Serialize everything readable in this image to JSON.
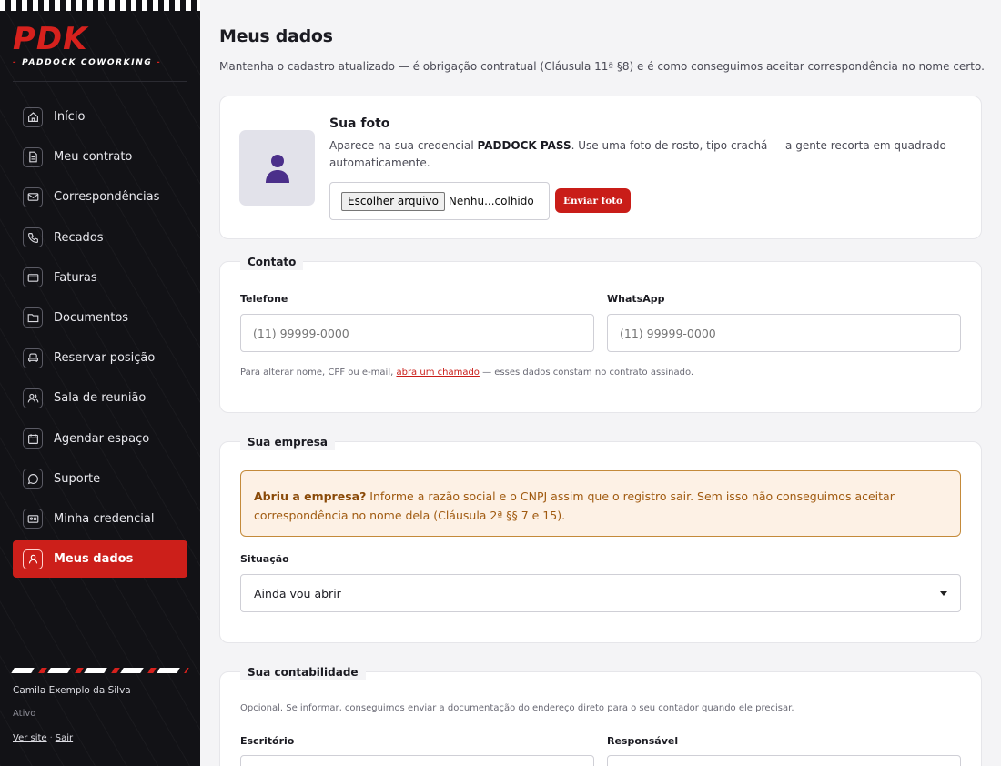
{
  "sidebar": {
    "logo": "PDK",
    "logo_sub_dash_left": "-",
    "logo_sub": "PADDOCK COWORKING",
    "logo_sub_dash_right": "-",
    "items": [
      {
        "label": "Início",
        "icon": "home-icon"
      },
      {
        "label": "Meu contrato",
        "icon": "document-icon"
      },
      {
        "label": "Correspondências",
        "icon": "mail-icon"
      },
      {
        "label": "Recados",
        "icon": "phone-icon"
      },
      {
        "label": "Faturas",
        "icon": "credit-card-icon"
      },
      {
        "label": "Documentos",
        "icon": "folder-icon"
      },
      {
        "label": "Reservar posição",
        "icon": "armchair-icon"
      },
      {
        "label": "Sala de reunião",
        "icon": "users-icon"
      },
      {
        "label": "Agendar espaço",
        "icon": "calendar-icon"
      },
      {
        "label": "Suporte",
        "icon": "chat-icon"
      },
      {
        "label": "Minha credencial",
        "icon": "id-card-icon"
      },
      {
        "label": "Meus dados",
        "icon": "user-icon",
        "active": true
      }
    ],
    "user_name": "Camila Exemplo da Silva",
    "user_status": "Ativo",
    "link_site": "Ver site",
    "link_sep": "·",
    "link_logout": "Sair"
  },
  "page": {
    "title": "Meus dados",
    "description": "Mantenha o cadastro atualizado — é obrigação contratual (Cláusula 11ª §8) e é como conseguimos aceitar correspondência no nome certo."
  },
  "photo": {
    "title": "Sua foto",
    "desc_prefix": "Aparece na sua credencial ",
    "desc_bold": "PADDOCK PASS",
    "desc_suffix": ". Use uma foto de rosto, tipo crachá — a gente recorta em quadrado automaticamente.",
    "file_button": "Escolher arquivo",
    "file_name": "Nenhu...colhido",
    "send_button": "Enviar foto"
  },
  "contato": {
    "legend": "Contato",
    "phone_label": "Telefone",
    "phone_placeholder": "(11) 99999-0000",
    "whatsapp_label": "WhatsApp",
    "whatsapp_placeholder": "(11) 99999-0000",
    "hint_prefix": "Para alterar nome, CPF ou e-mail, ",
    "hint_link": "abra um chamado",
    "hint_suffix": " — esses dados constam no contrato assinado."
  },
  "empresa": {
    "legend": "Sua empresa",
    "alert_bold": "Abriu a empresa?",
    "alert_text": " Informe a razão social e o CNPJ assim que o registro sair. Sem isso não conseguimos aceitar correspondência no nome dela (Cláusula 2ª §§ 7 e 15).",
    "situacao_label": "Situação",
    "situacao_value": "Ainda vou abrir"
  },
  "contabilidade": {
    "legend": "Sua contabilidade",
    "hint": "Opcional. Se informar, conseguimos enviar a documentação do endereço direto para o seu contador quando ele precisar.",
    "escritorio_label": "Escritório",
    "responsavel_label": "Responsável"
  },
  "colors": {
    "brand_red": "#cc1f1a",
    "sidebar_bg": "#121216",
    "alert_bg": "#fdf1e5",
    "alert_border": "#c48a3a"
  }
}
